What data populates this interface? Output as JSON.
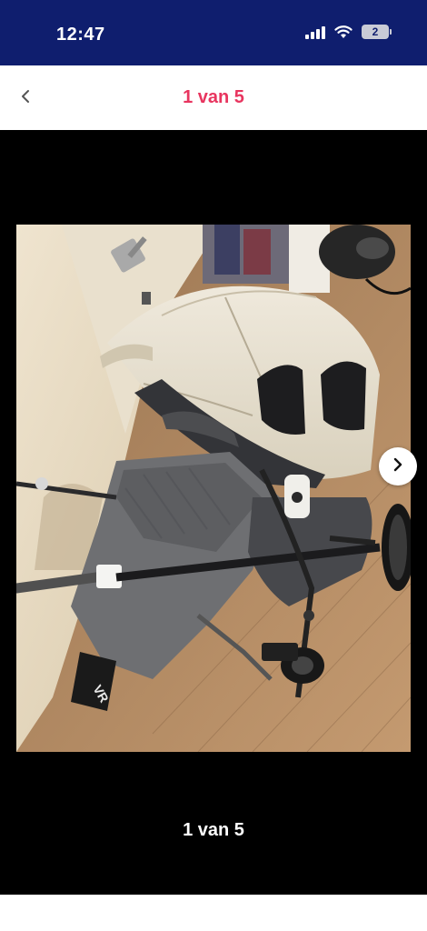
{
  "status_bar": {
    "time": "12:47",
    "battery": "2",
    "icons": [
      "signal-icon",
      "wifi-icon",
      "battery-icon"
    ]
  },
  "header": {
    "title": "1 van 5",
    "back_icon": "chevron-left-icon",
    "title_color": "#e8355f"
  },
  "gallery": {
    "counter": "1 van 5",
    "current_index": 1,
    "total": 5,
    "image_alt": "Bugaboo kinderwagen met beige kap",
    "next_icon": "chevron-right-icon",
    "footmuff_text": "VR"
  },
  "colors": {
    "status_bar": "#0f1e6e",
    "accent": "#e8355f",
    "background": "#000000"
  }
}
